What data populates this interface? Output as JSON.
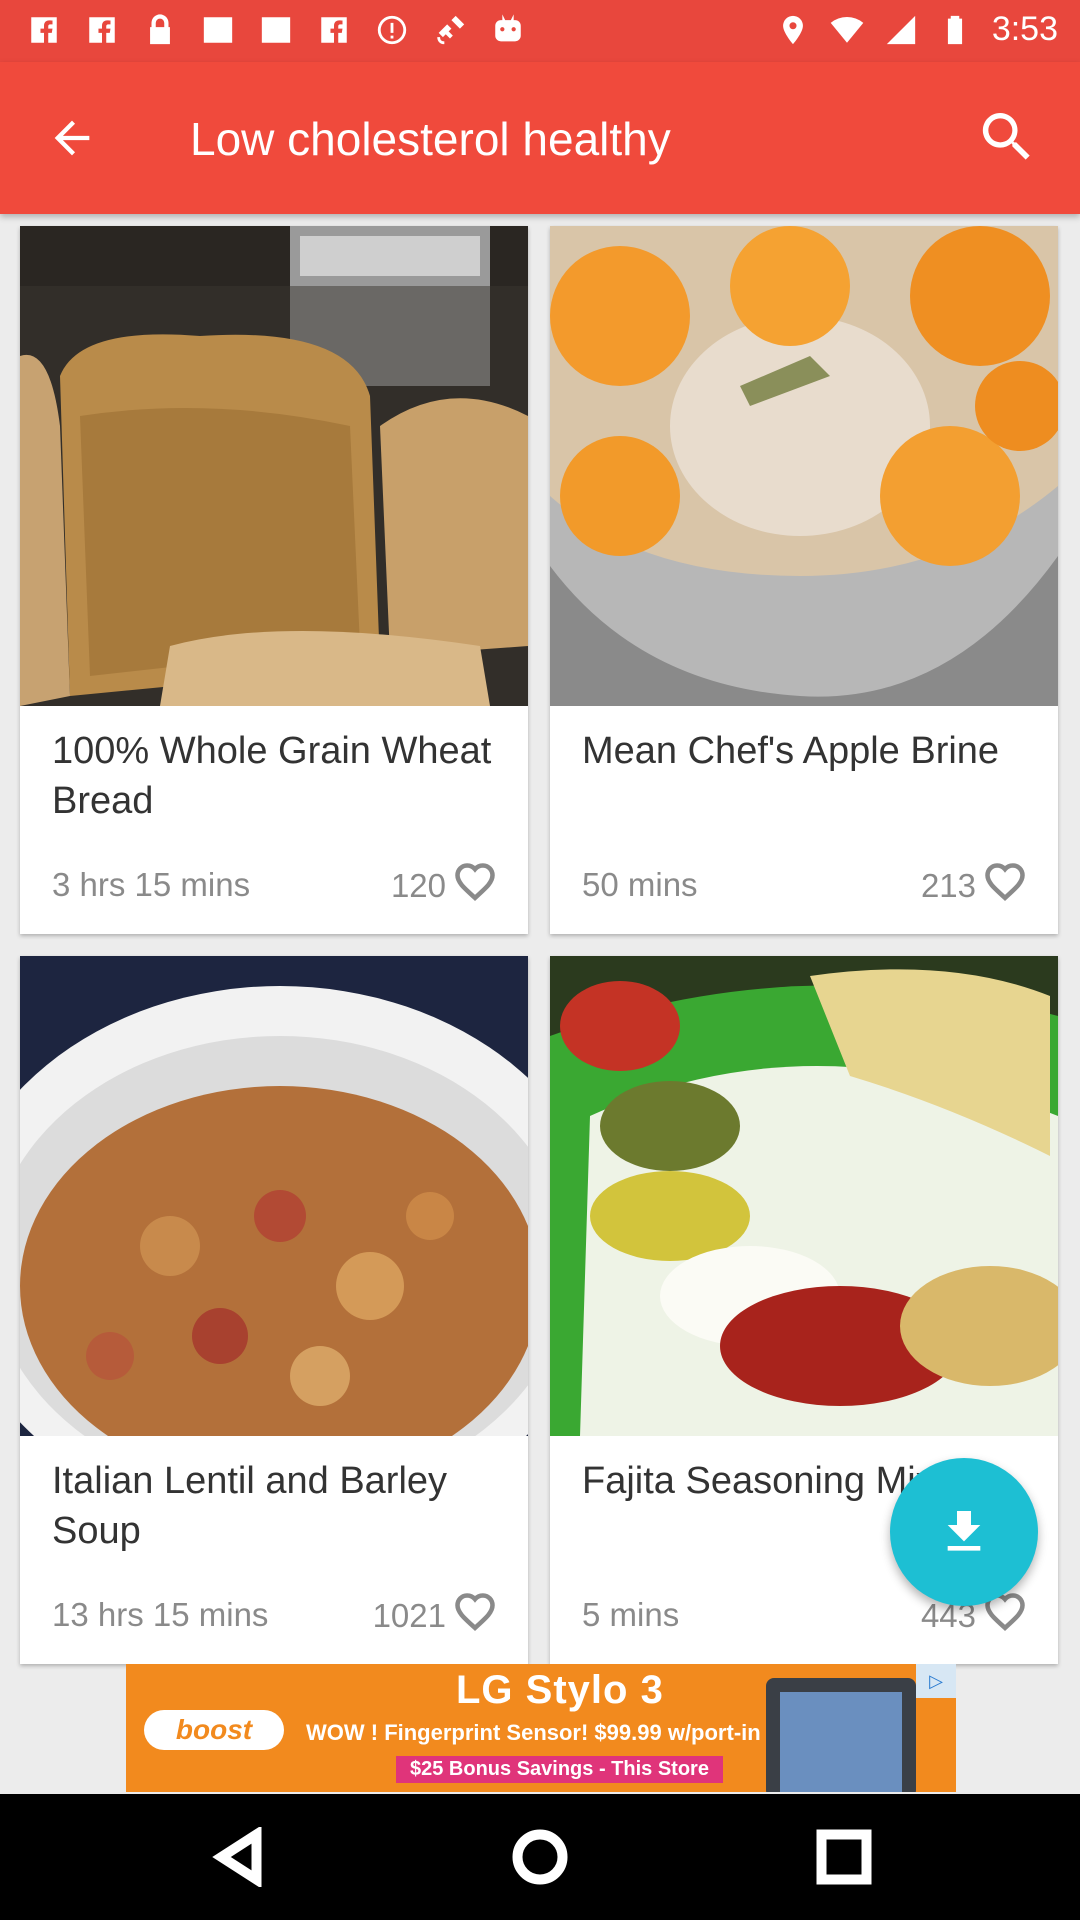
{
  "status_bar": {
    "time": "3:53",
    "icons": [
      "facebook-icon",
      "facebook-icon",
      "lock-icon",
      "blank-icon",
      "blank-icon",
      "facebook-icon",
      "alert-icon",
      "satellite-icon",
      "robot-icon"
    ],
    "right_icons": [
      "location-icon",
      "wifi-icon",
      "signal-icon",
      "battery-icon"
    ]
  },
  "app_bar": {
    "title": "Low cholesterol healthy",
    "back_icon": "arrow-back-icon",
    "search_icon": "search-icon",
    "color": "#f04a3c"
  },
  "recipes": [
    {
      "title": "100% Whole Grain Wheat Bread",
      "time": "3 hrs 15 mins",
      "likes": "120"
    },
    {
      "title": "Mean Chef's Apple Brine",
      "time": "50 mins",
      "likes": "213"
    },
    {
      "title": "Italian Lentil and Barley Soup",
      "time": "13 hrs 15 mins",
      "likes": "1021"
    },
    {
      "title": "Fajita Seasoning Mix",
      "time": "5 mins",
      "likes": "443"
    }
  ],
  "fab": {
    "icon": "download-icon",
    "color": "#1dbfd3"
  },
  "ad": {
    "title": "LG Stylo 3",
    "brand": "boost",
    "line1": "WOW ! Fingerprint Sensor! $99.99 w/port-in",
    "line2": "$25 Bonus Savings - This Store"
  }
}
